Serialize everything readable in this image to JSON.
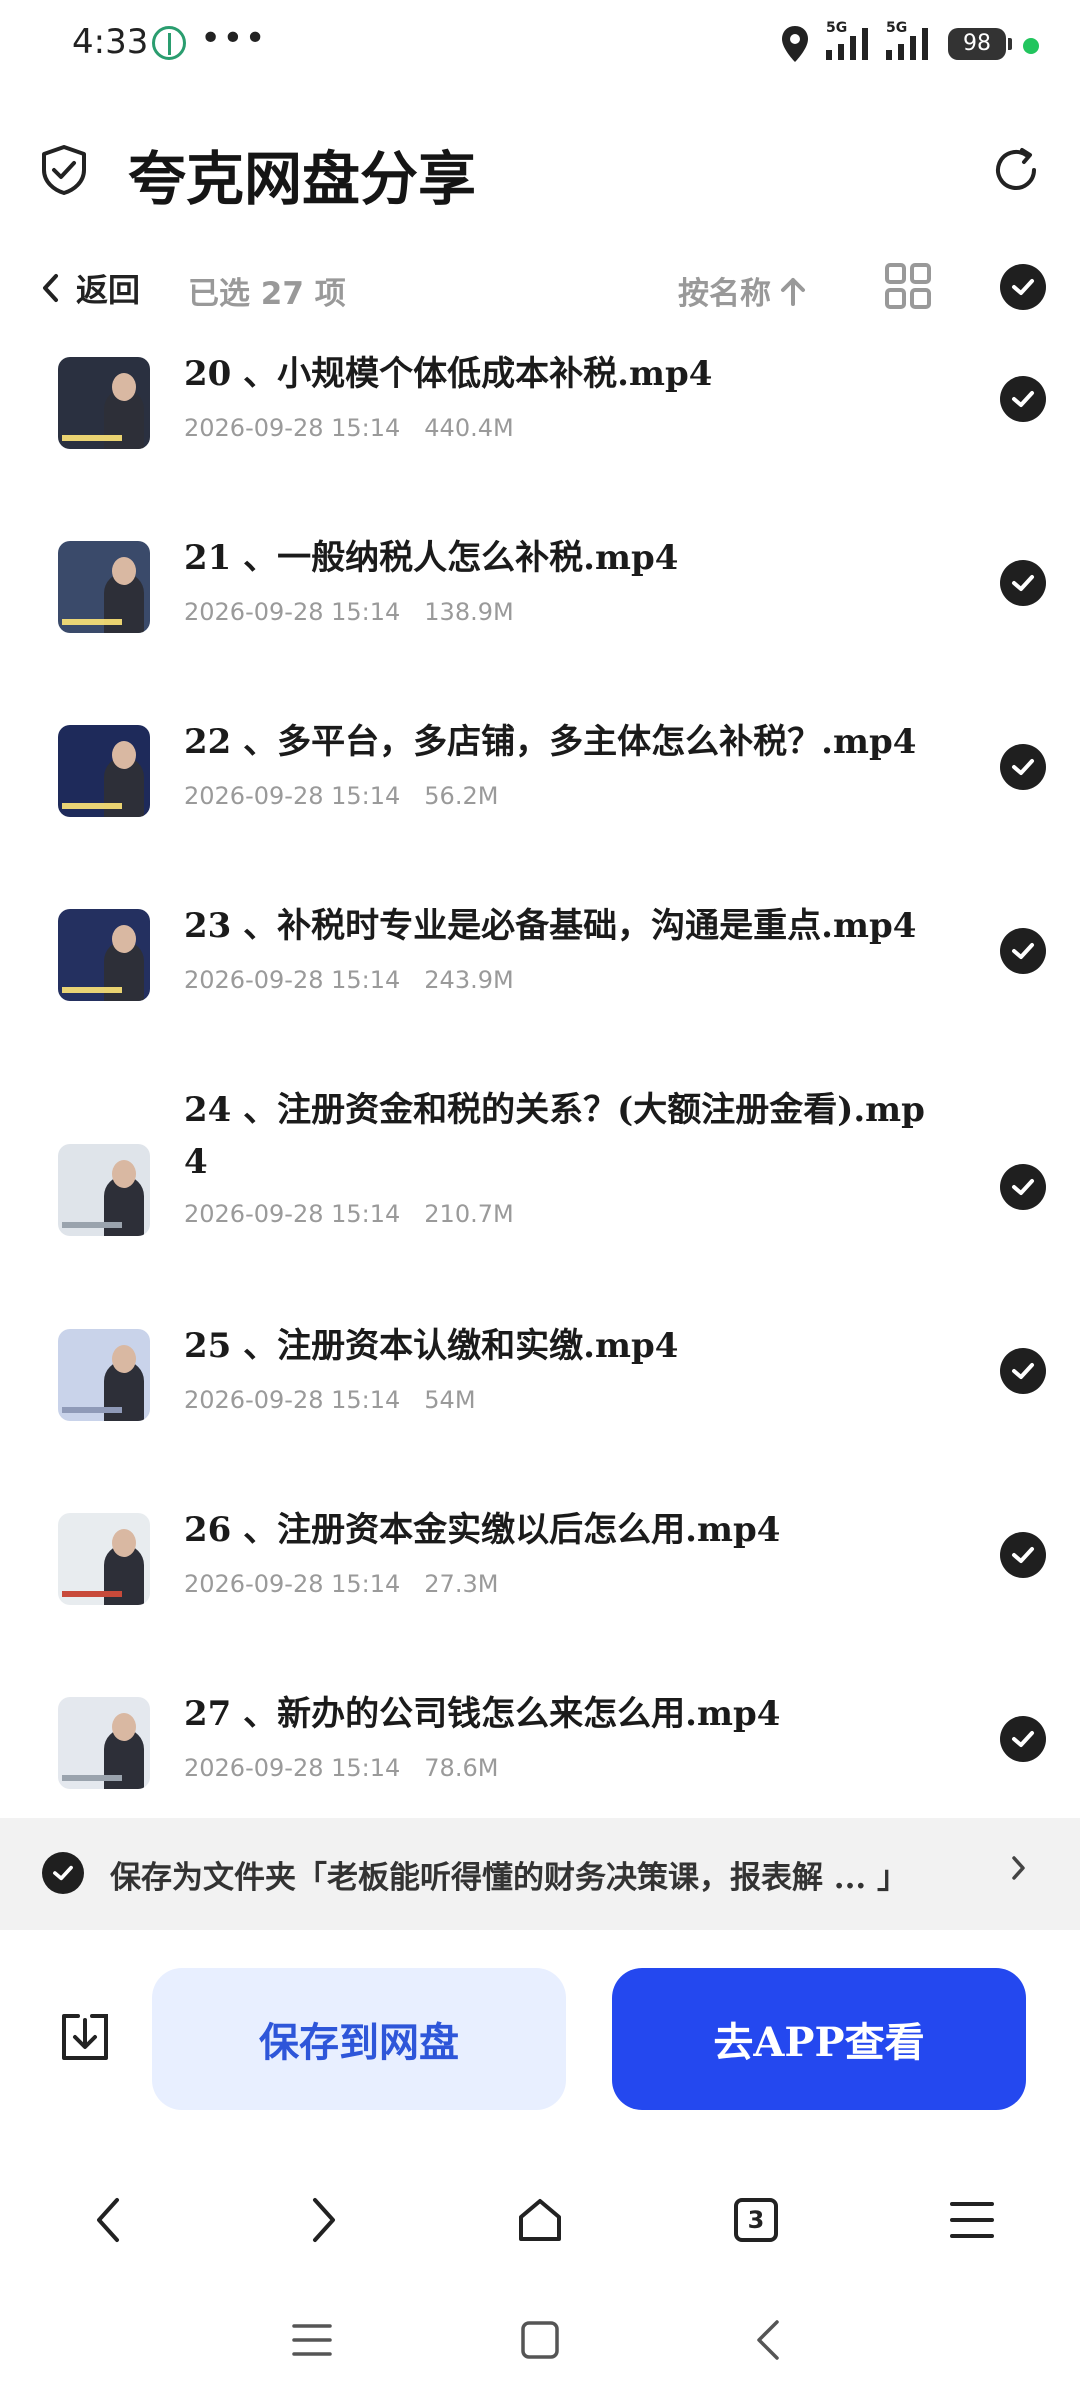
{
  "status_bar": {
    "time": "4:33",
    "more": "•••",
    "signal_1_label": "5G",
    "signal_2_label": "5G",
    "battery": "98"
  },
  "header": {
    "title": "夸克网盘分享"
  },
  "toolbar": {
    "back_label": "返回",
    "selected_label": "已选 27 项",
    "sort_label": "按名称"
  },
  "files": [
    {
      "name": "20 、小规模个体低成本补税.mp4",
      "date": "2026-09-28 15:14",
      "size": "440.4M",
      "selected": true,
      "thumb_color": "#2a3040"
    },
    {
      "name": "21 、一般纳税人怎么补税.mp4",
      "date": "2026-09-28 15:14",
      "size": "138.9M",
      "selected": true,
      "thumb_color": "#3a4a6a"
    },
    {
      "name": "22 、多平台，多店铺，多主体怎么补税？.mp4",
      "date": "2026-09-28 15:14",
      "size": "56.2M",
      "selected": true,
      "thumb_color": "#1e2a5a"
    },
    {
      "name": "23 、补税时专业是必备基础，沟通是重点.mp4",
      "date": "2026-09-28 15:14",
      "size": "243.9M",
      "selected": true,
      "thumb_color": "#243060"
    },
    {
      "name": "24 、注册资金和税的关系？(大额注册金看).mp4",
      "date": "2026-09-28 15:14",
      "size": "210.7M",
      "selected": true,
      "thumb_color": "#dfe4ea"
    },
    {
      "name": "25 、注册资本认缴和实缴.mp4",
      "date": "2026-09-28 15:14",
      "size": "54M",
      "selected": true,
      "thumb_color": "#c9d3ea"
    },
    {
      "name": "26 、注册资本金实缴以后怎么用.mp4",
      "date": "2026-09-28 15:14",
      "size": "27.3M",
      "selected": true,
      "thumb_color": "#e8ecef"
    },
    {
      "name": "27 、新办的公司钱怎么来怎么用.mp4",
      "date": "2026-09-28 15:14",
      "size": "78.6M",
      "selected": true,
      "thumb_color": "#e4e8ee"
    }
  ],
  "folder_bar": {
    "text": "保存为文件夹「老板能听得懂的财务决策课，报表解 ... 」"
  },
  "actions": {
    "save_label": "保存到网盘",
    "open_app_label": "去APP查看"
  },
  "browser_nav": {
    "tab_count": "3"
  },
  "colors": {
    "accent": "#2448ef",
    "save_bg": "#e8efff",
    "save_text": "#2e56d9",
    "folder_bar_bg": "#f2f2f2",
    "battery_dot": "#22c55e"
  }
}
